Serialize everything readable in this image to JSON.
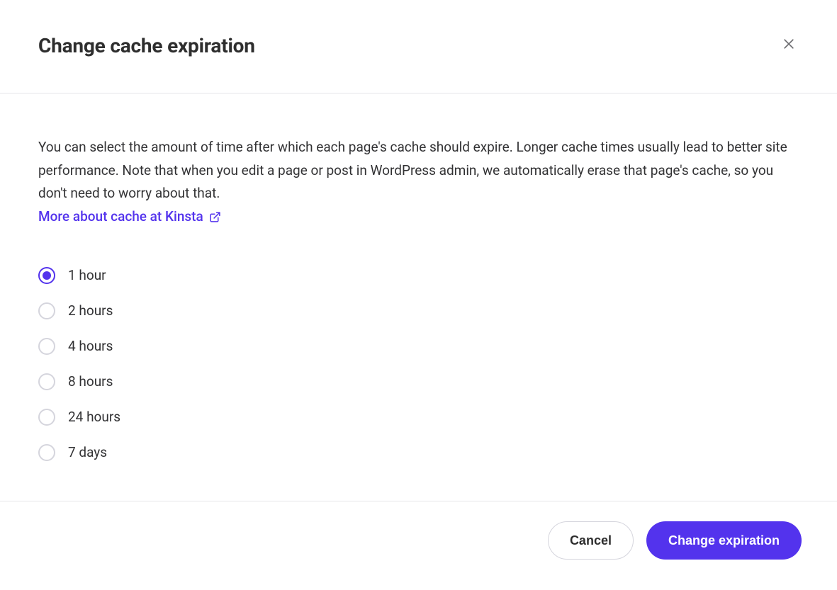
{
  "header": {
    "title": "Change cache expiration"
  },
  "body": {
    "description": "You can select the amount of time after which each page's cache should expire. Longer cache times usually lead to better site performance. Note that when you edit a page or post in WordPress admin, we automatically erase that page's cache, so you don't need to worry about that.",
    "learn_more_label": "More about cache at Kinsta"
  },
  "options": [
    {
      "label": "1 hour",
      "selected": true
    },
    {
      "label": "2 hours",
      "selected": false
    },
    {
      "label": "4 hours",
      "selected": false
    },
    {
      "label": "8 hours",
      "selected": false
    },
    {
      "label": "24 hours",
      "selected": false
    },
    {
      "label": "7 days",
      "selected": false
    }
  ],
  "footer": {
    "cancel_label": "Cancel",
    "confirm_label": "Change expiration"
  },
  "colors": {
    "accent": "#5333ed",
    "border": "#e6e6e9",
    "text": "#2e2e2e"
  }
}
